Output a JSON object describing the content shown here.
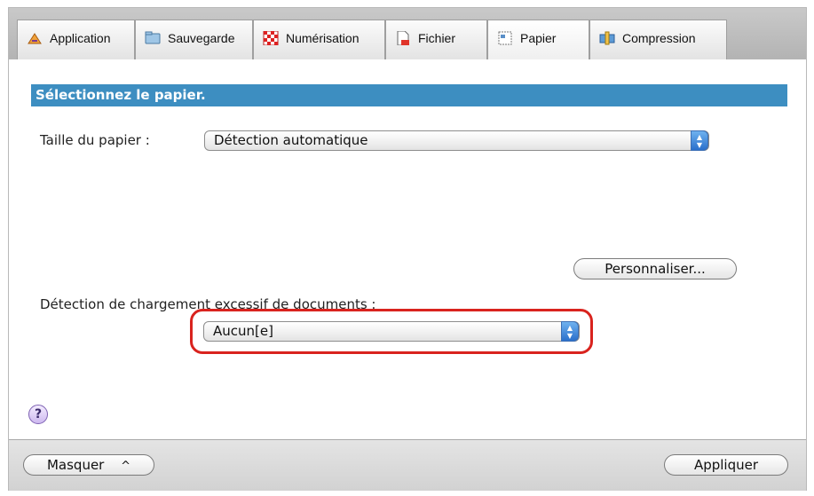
{
  "tabs": [
    {
      "label": "Application",
      "icon": "application-icon"
    },
    {
      "label": "Sauvegarde",
      "icon": "save-folder-icon"
    },
    {
      "label": "Numérisation",
      "icon": "scan-icon"
    },
    {
      "label": "Fichier",
      "icon": "file-icon"
    },
    {
      "label": "Papier",
      "icon": "paper-icon",
      "active": true
    },
    {
      "label": "Compression",
      "icon": "compression-icon"
    }
  ],
  "section": {
    "title": "Sélectionnez le papier."
  },
  "paper_size": {
    "label": "Taille du papier :",
    "value": "Détection automatique"
  },
  "customize_button": "Personnaliser...",
  "multifeed": {
    "label": "Détection de chargement excessif de documents :",
    "value": "Aucun[e]"
  },
  "help": "?",
  "footer": {
    "hide_button": "Masquer",
    "hide_glyph": "^",
    "apply_button": "Appliquer"
  },
  "colors": {
    "section_bar": "#3d8ec1",
    "highlight": "#d9231e",
    "stepper": "#2a6fcb"
  }
}
